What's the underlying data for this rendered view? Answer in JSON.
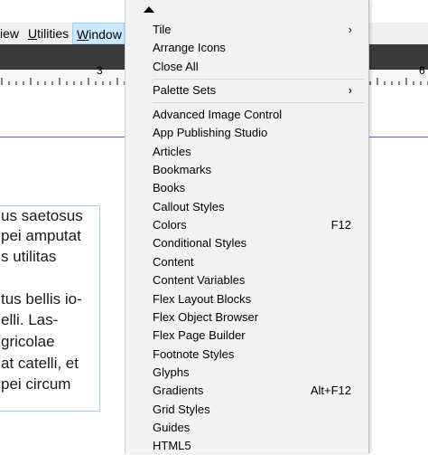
{
  "menubar": {
    "items": [
      {
        "label": "iew",
        "underline_char": ""
      },
      {
        "label": "Utilities",
        "underline_char": "U"
      },
      {
        "label": "Window",
        "underline_char": "W"
      }
    ]
  },
  "ruler": {
    "numbers": [
      "3",
      "6"
    ]
  },
  "document": {
    "text_lines": [
      "us saetosus",
      "pei amputat",
      "s utilitas",
      "",
      "tus bellis io-",
      "elli. Las-",
      "gricolae",
      "at catelli, et",
      "pei circum"
    ]
  },
  "window_menu": {
    "group1": [
      {
        "label": "Tile",
        "submenu": "›"
      },
      {
        "label": "Arrange Icons"
      },
      {
        "label": "Close All"
      }
    ],
    "group2": [
      {
        "label": "Palette Sets",
        "submenu": "›"
      }
    ],
    "group3": [
      {
        "label": "Advanced Image Control"
      },
      {
        "label": "App Publishing Studio"
      },
      {
        "label": "Articles"
      },
      {
        "label": "Bookmarks"
      },
      {
        "label": "Books"
      },
      {
        "label": "Callout Styles"
      },
      {
        "label": "Colors",
        "shortcut": "F12"
      },
      {
        "label": "Conditional Styles"
      },
      {
        "label": "Content"
      },
      {
        "label": "Content Variables"
      },
      {
        "label": "Flex Layout Blocks"
      },
      {
        "label": "Flex Object Browser"
      },
      {
        "label": "Flex Page Builder"
      },
      {
        "label": "Footnote Styles"
      },
      {
        "label": "Glyphs"
      },
      {
        "label": "Gradients",
        "shortcut": "Alt+F12"
      },
      {
        "label": "Grid Styles"
      },
      {
        "label": "Guides"
      },
      {
        "label": "HTML5"
      }
    ]
  }
}
